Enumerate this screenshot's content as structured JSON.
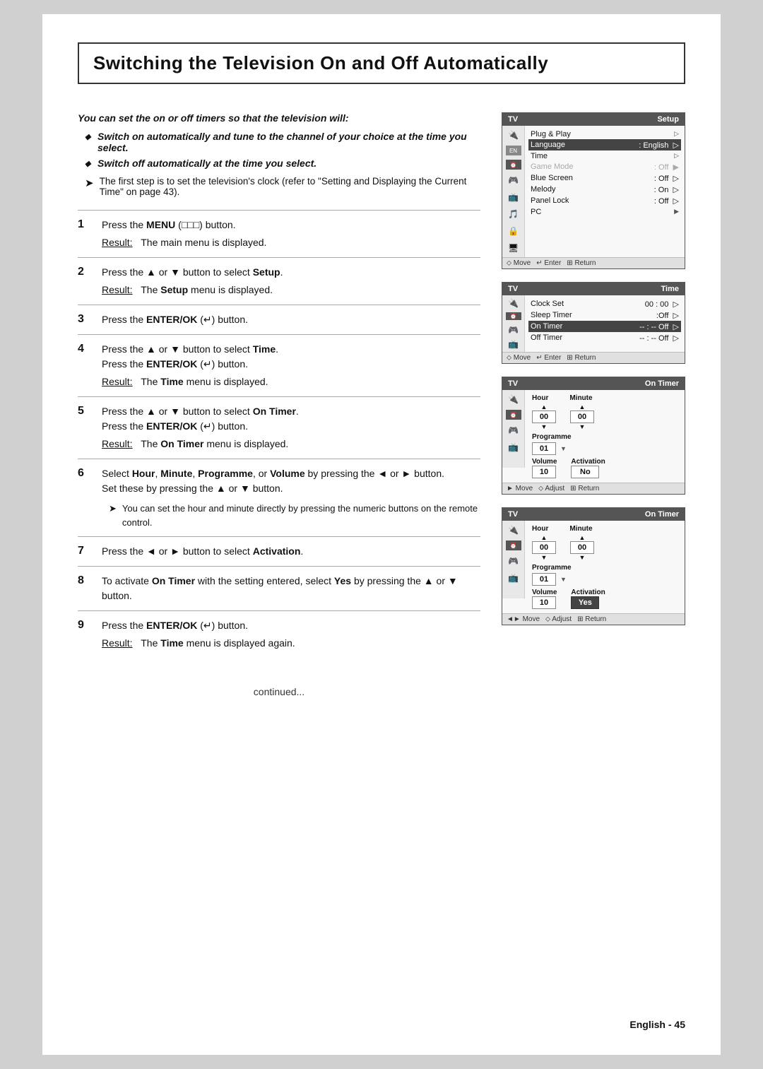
{
  "title": "Switching the Television On and Off Automatically",
  "intro": {
    "bold_lead": "You can set the on or off timers so that the television will:",
    "bullets": [
      "Switch on automatically and tune to the channel of your choice at the time you select.",
      "Switch off automatically at the time you select."
    ],
    "note": "The first step is to set the television's clock (refer to \"Setting and Displaying the Current Time\" on page 43)."
  },
  "steps": [
    {
      "num": "1",
      "text": "Press the MENU (□□□) button.",
      "result": "The main menu is displayed."
    },
    {
      "num": "2",
      "text": "Press the ▲ or ▼ button to select Setup.",
      "result": "The Setup menu is displayed."
    },
    {
      "num": "3",
      "text": "Press the ENTER/OK (↵) button.",
      "result": null
    },
    {
      "num": "4",
      "text": "Press the ▲ or ▼ button to select Time. Press the ENTER/OK (↵) button.",
      "result": "The Time menu is displayed."
    },
    {
      "num": "5",
      "text": "Press the ▲ or ▼ button to select On Timer. Press the ENTER/OK (↵) button.",
      "result": "The On Timer menu is displayed."
    },
    {
      "num": "6",
      "text": "Select Hour, Minute, Programme, or Volume by pressing the ◄ or ► button. Set these by pressing the ▲ or ▼ button.",
      "subnote": "You can set the hour and minute directly by pressing the numeric buttons on the remote control."
    },
    {
      "num": "7",
      "text": "Press the ◄ or ► button to select Activation.",
      "result": null
    },
    {
      "num": "8",
      "text": "To activate On Timer with the setting entered, select Yes by pressing the ▲ or ▼ button.",
      "result": null
    },
    {
      "num": "9",
      "text": "Press the ENTER/OK (↵) button.",
      "result": "The Time menu is displayed again."
    }
  ],
  "continued": "continued...",
  "footer_page": "English - 45",
  "screens": {
    "setup": {
      "title_left": "TV",
      "title_right": "Setup",
      "rows": [
        {
          "key": "Plug & Play",
          "val": "",
          "arrow": "▷",
          "highlighted": false
        },
        {
          "key": "Language",
          "val": ": English",
          "arrow": "▷",
          "highlighted": true
        },
        {
          "key": "Time",
          "val": "",
          "arrow": "▷",
          "highlighted": false
        },
        {
          "key": "Game Mode",
          "val": ": Off",
          "arrow": "▶",
          "highlighted": false
        },
        {
          "key": "Blue Screen",
          "val": ": Off",
          "arrow": "▷",
          "highlighted": false
        },
        {
          "key": "Melody",
          "val": ": On",
          "arrow": "▷",
          "highlighted": false
        },
        {
          "key": "Panel Lock",
          "val": ": Off",
          "arrow": "▷",
          "highlighted": false
        },
        {
          "key": "PC",
          "val": "",
          "arrow": "▶",
          "highlighted": false
        }
      ],
      "footer": "⬦ Move  ↵ Enter  ⊞ Return"
    },
    "time": {
      "title_left": "TV",
      "title_right": "Time",
      "rows": [
        {
          "key": "Clock Set",
          "val": "00 : 00",
          "arrow": "▷",
          "highlighted": false
        },
        {
          "key": "Sleep Timer",
          "val": ":Off",
          "arrow": "▷",
          "highlighted": false
        },
        {
          "key": "On Timer",
          "val": "-- : --  Off",
          "arrow": "▷",
          "highlighted": true
        },
        {
          "key": "Off Timer",
          "val": "-- : --  Off",
          "arrow": "▷",
          "highlighted": false
        }
      ],
      "footer": "⬦ Move  ↵ Enter  ⊞ Return"
    },
    "on_timer_1": {
      "title_left": "TV",
      "title_right": "On Timer",
      "hour": "00",
      "minute": "00",
      "programme": "01",
      "volume": "10",
      "activation": "No",
      "footer": "► Move  ⬦ Adjust  ⊞ Return"
    },
    "on_timer_2": {
      "title_left": "TV",
      "title_right": "On Timer",
      "hour": "00",
      "minute": "00",
      "programme": "01",
      "volume": "10",
      "activation": "Yes",
      "footer": "◄► Move  ⬦ Adjust  ⊞ Return"
    }
  }
}
